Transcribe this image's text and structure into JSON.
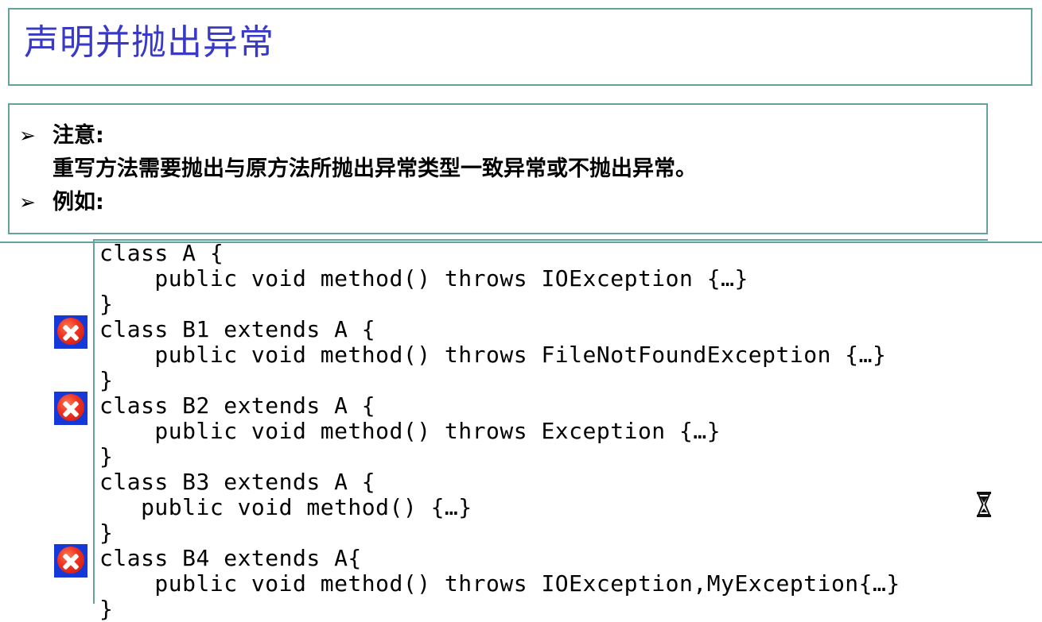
{
  "slide": {
    "title": "声明并抛出异常",
    "title_color": "#3939c8",
    "border_color": "#63a39b"
  },
  "note": {
    "lines": [
      {
        "bullet": "➢",
        "text": "注意:"
      },
      {
        "bullet": "",
        "text": "重写方法需要抛出与原方法所抛出异常类型一致异常或不抛出异常。"
      },
      {
        "bullet": "➢",
        "text": "例如:"
      }
    ]
  },
  "code": {
    "lines": [
      {
        "text": "class A {",
        "error": false
      },
      {
        "text": "    public void method() throws IOException {…}",
        "error": false
      },
      {
        "text": "}",
        "error": false
      },
      {
        "text": "class B1 extends A {",
        "error": true
      },
      {
        "text": "    public void method() throws FileNotFoundException {…}",
        "error": false
      },
      {
        "text": "}",
        "error": false
      },
      {
        "text": "class B2 extends A {",
        "error": true
      },
      {
        "text": "    public void method() throws Exception {…}",
        "error": false
      },
      {
        "text": "}",
        "error": false
      },
      {
        "text": "class B3 extends A {",
        "error": false
      },
      {
        "text": "   public void method() {…}",
        "error": false
      },
      {
        "text": "}",
        "error": false
      },
      {
        "text": "class B4 extends A{",
        "error": true
      },
      {
        "text": "    public void method() throws IOException,MyException{…}",
        "error": false
      },
      {
        "text": "}",
        "error": false
      }
    ],
    "error_icon_name": "error-x-icon",
    "error_icon_color": "#1538d8"
  },
  "cursor": {
    "glyph": "⌛",
    "name": "hourglass-wait-cursor"
  }
}
